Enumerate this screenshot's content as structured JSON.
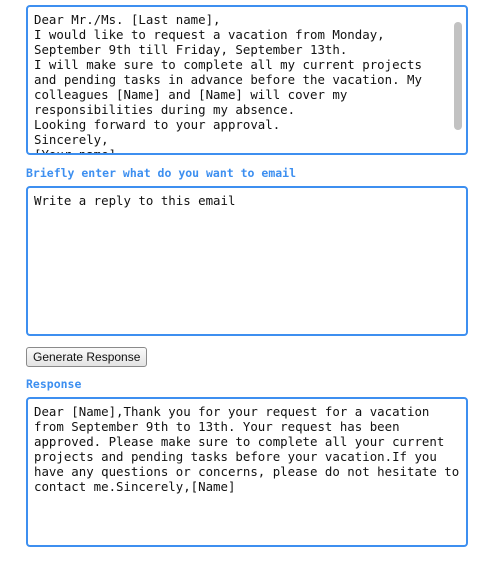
{
  "email_input": {
    "text": "Dear Mr./Ms. [Last name],\nI would like to request a vacation from Monday, September 9th till Friday, September 13th.\nI will make sure to complete all my current projects and pending tasks in advance before the vacation. My colleagues [Name] and [Name] will cover my responsibilities during my absence.\nLooking forward to your approval.\nSincerely,\n[Your name]"
  },
  "prompt": {
    "label": "Briefly enter what do you want to email",
    "value": "Write a reply to this email"
  },
  "generate_button": {
    "label": "Generate Response"
  },
  "response": {
    "label": "Response",
    "text": "Dear [Name],Thank you for your request for a vacation from September 9th to 13th. Your request has been approved. Please make sure to complete all your current projects and pending tasks before your vacation.If you have any questions or concerns, please do not hesitate to contact me.Sincerely,[Name]"
  },
  "colors": {
    "accent": "#3d8ff0",
    "text": "#111111",
    "scrollbar_thumb": "#c2c2c2"
  }
}
